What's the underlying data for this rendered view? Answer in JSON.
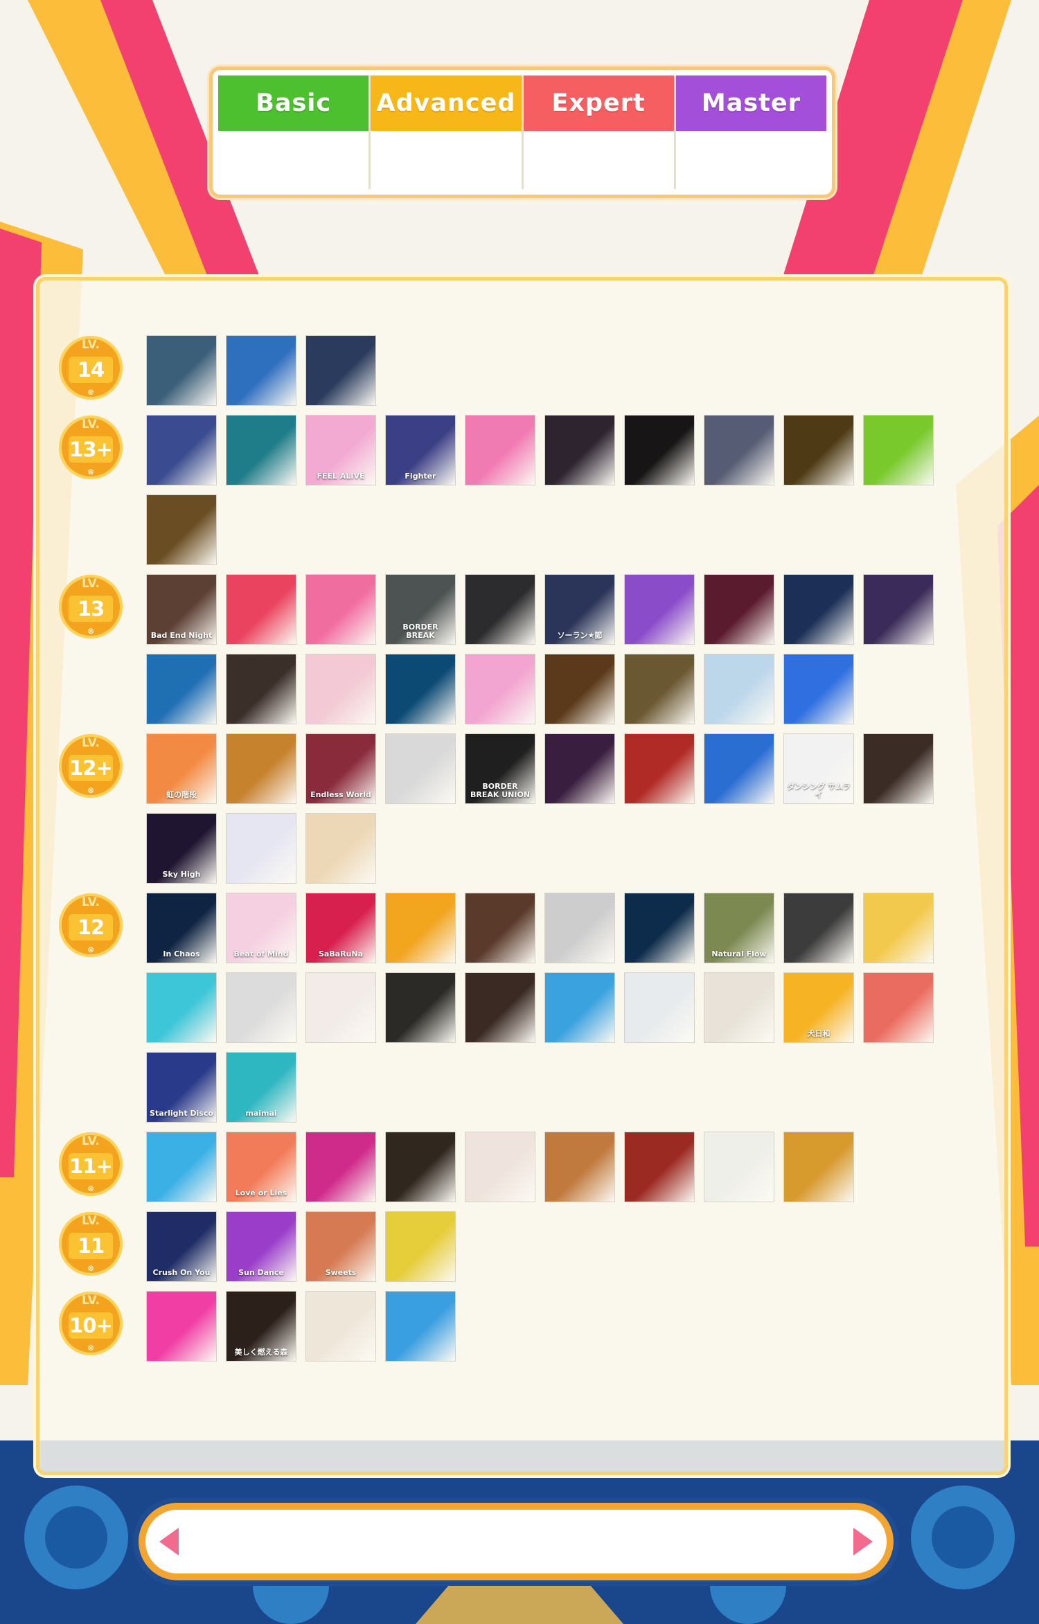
{
  "tabs": [
    {
      "label": "Basic",
      "color": "#4cc02f"
    },
    {
      "label": "Advanced",
      "color": "#f8b718"
    },
    {
      "label": "Expert",
      "color": "#f55f62"
    },
    {
      "label": "Master",
      "color": "#a34fd9"
    }
  ],
  "levels": [
    {
      "lv": "LV.",
      "value": "14",
      "mark": "⊗",
      "covers": [
        {
          "color": "#3c5f79"
        },
        {
          "color": "#2e6fbe"
        },
        {
          "color": "#2a3b5d"
        }
      ]
    },
    {
      "lv": "LV.",
      "value": "13+",
      "mark": "⊗",
      "covers": [
        {
          "color": "#3a4b8f"
        },
        {
          "color": "#1f7d8a"
        },
        {
          "color": "#f2a9d2",
          "text": "FEEL ALIVE"
        },
        {
          "color": "#3b3f85",
          "text": "Fighter"
        },
        {
          "color": "#f07ab2"
        },
        {
          "color": "#2e2430"
        },
        {
          "color": "#181516"
        },
        {
          "color": "#565c73"
        },
        {
          "color": "#4e3b16"
        },
        {
          "color": "#7ac92c"
        },
        {
          "color": "#6a4d22"
        }
      ]
    },
    {
      "lv": "LV.",
      "value": "13",
      "mark": "⊗",
      "covers": [
        {
          "color": "#5c4034",
          "text": "Bad End Night"
        },
        {
          "color": "#e9435f"
        },
        {
          "color": "#f06da0"
        },
        {
          "color": "#4d5352",
          "text": "BORDER BREAK"
        },
        {
          "color": "#2c2c2e"
        },
        {
          "color": "#2b355a",
          "text": "ソーラン★節"
        },
        {
          "color": "#8a4cc9"
        },
        {
          "color": "#5a1b2e"
        },
        {
          "color": "#1b2f57"
        },
        {
          "color": "#3b2b5a"
        },
        {
          "color": "#1f6fb3"
        },
        {
          "color": "#3b2f2a"
        },
        {
          "color": "#f2c9d4"
        },
        {
          "color": "#0c4a74"
        },
        {
          "color": "#f2a5d0"
        },
        {
          "color": "#5a3a1a"
        },
        {
          "color": "#6a5833"
        },
        {
          "color": "#bcd6ea"
        },
        {
          "color": "#2f6fe0"
        }
      ]
    },
    {
      "lv": "LV.",
      "value": "12+",
      "mark": "⊗",
      "covers": [
        {
          "color": "#f28a43",
          "text": "虹の階段"
        },
        {
          "color": "#c7822e"
        },
        {
          "color": "#8a2b3c",
          "text": "Endless World"
        },
        {
          "color": "#d9d9d9"
        },
        {
          "color": "#1f1f1f",
          "text": "BORDER BREAK UNION"
        },
        {
          "color": "#3a1e3f"
        },
        {
          "color": "#b02a26"
        },
        {
          "color": "#2b6ed2"
        },
        {
          "color": "#f2f2f2",
          "text": "ダンシング サムライ"
        },
        {
          "color": "#3b2c26"
        },
        {
          "color": "#1f1530",
          "text": "Sky High"
        },
        {
          "color": "#e6e6f2"
        },
        {
          "color": "#ecd8b6"
        }
      ]
    },
    {
      "lv": "LV.",
      "value": "12",
      "mark": "⊗",
      "covers": [
        {
          "color": "#0f2342",
          "text": "In Chaos"
        },
        {
          "color": "#f5d0e1",
          "text": "Beat of Mind"
        },
        {
          "color": "#d8204e",
          "text": "SaBaRuNa"
        },
        {
          "color": "#f2a51e"
        },
        {
          "color": "#5a3a2b"
        },
        {
          "color": "#cdcdcd"
        },
        {
          "color": "#0d2b4a"
        },
        {
          "color": "#7c8a52",
          "text": "Natural Flow"
        },
        {
          "color": "#3c3c3c"
        },
        {
          "color": "#f3c94d"
        },
        {
          "color": "#3cc6d8"
        },
        {
          "color": "#dcdcdc"
        },
        {
          "color": "#f2ebe8"
        },
        {
          "color": "#2b2a26"
        },
        {
          "color": "#3b2a24"
        },
        {
          "color": "#39a2df"
        },
        {
          "color": "#e7ebee"
        },
        {
          "color": "#e8e2d8"
        },
        {
          "color": "#f6b323",
          "text": "犬日和"
        },
        {
          "color": "#ea6b5f"
        },
        {
          "color": "#2a3a8a",
          "text": "Starlight Disco"
        },
        {
          "color": "#2fb7c1",
          "text": "maimai"
        }
      ]
    },
    {
      "lv": "LV.",
      "value": "11+",
      "mark": "⊗",
      "covers": [
        {
          "color": "#3ab0e5"
        },
        {
          "color": "#f27b59",
          "text": "Love or Lies"
        },
        {
          "color": "#ce2b8a"
        },
        {
          "color": "#30271f"
        },
        {
          "color": "#efe3dd"
        },
        {
          "color": "#c07a3d"
        },
        {
          "color": "#9a2a22"
        },
        {
          "color": "#efefe9"
        },
        {
          "color": "#d79a2d"
        }
      ]
    },
    {
      "lv": "LV.",
      "value": "11",
      "mark": "⊗",
      "covers": [
        {
          "color": "#1f2c66",
          "text": "Crush On You"
        },
        {
          "color": "#9a3ec9",
          "text": "Sun Dance"
        },
        {
          "color": "#d57a52",
          "text": "Sweets"
        },
        {
          "color": "#e6cd3a"
        }
      ]
    },
    {
      "lv": "LV.",
      "value": "10+",
      "mark": "⊗",
      "covers": [
        {
          "color": "#f03ea4"
        },
        {
          "color": "#2c201b",
          "text": "美しく燃える森"
        },
        {
          "color": "#efe6da"
        },
        {
          "color": "#3a9fe0"
        }
      ]
    }
  ]
}
